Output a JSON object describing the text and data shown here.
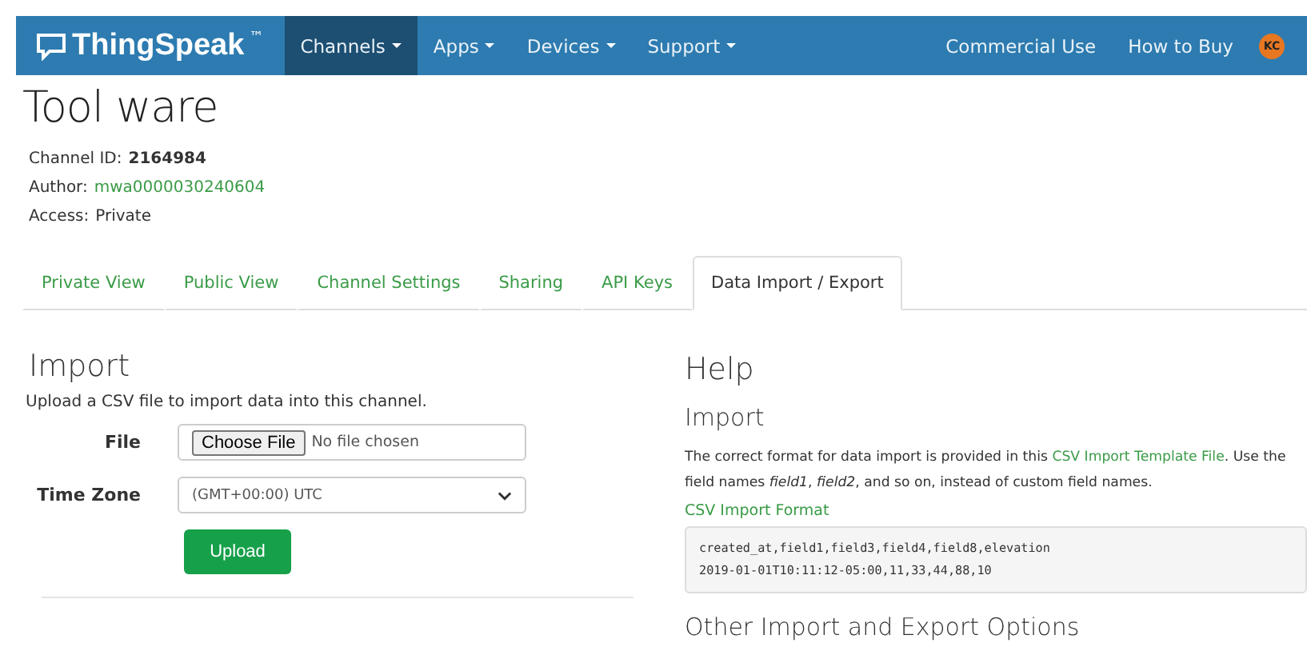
{
  "navbar": {
    "brand": "ThingSpeak",
    "trademark": "™",
    "menus": [
      {
        "label": "Channels",
        "selected": true,
        "caret": true
      },
      {
        "label": "Apps",
        "selected": false,
        "caret": true
      },
      {
        "label": "Devices",
        "selected": false,
        "caret": true
      },
      {
        "label": "Support",
        "selected": false,
        "caret": true
      }
    ],
    "links": [
      "Commercial Use",
      "How to Buy"
    ],
    "avatar": "KC"
  },
  "channel": {
    "title": "Tool ware",
    "info": [
      {
        "label": "Channel ID:",
        "value": "2164984",
        "kind": "bold"
      },
      {
        "label": "Author:",
        "value": "mwa0000030240604",
        "kind": "link"
      },
      {
        "label": "Access:",
        "value": "Private",
        "kind": "plain"
      }
    ]
  },
  "tabs": [
    {
      "label": "Private View",
      "selected": false
    },
    {
      "label": "Public View",
      "selected": false
    },
    {
      "label": "Channel Settings",
      "selected": false
    },
    {
      "label": "Sharing",
      "selected": false
    },
    {
      "label": "API Keys",
      "selected": false
    },
    {
      "label": "Data Import / Export",
      "selected": true
    }
  ],
  "import": {
    "heading": "Import",
    "description": "Upload a CSV file to import data into this channel.",
    "file": {
      "label": "File",
      "button": "Choose File",
      "status": "No file chosen"
    },
    "timezone": {
      "label": "Time Zone",
      "value": "(GMT+00:00) UTC"
    },
    "upload": "Upload"
  },
  "help": {
    "heading": "Help",
    "subheading": "Import",
    "text_before": "The correct format for data import is provided in this ",
    "link": "CSV Import Template File",
    "text_after": ". Use the field names *field1*, *field2*, and so on, instead of custom field names.",
    "format_label": "CSV Import Format",
    "code": [
      "created_at,field1,field3,field4,field8,elevation",
      "2019-01-01T10:11:12-05:00,11,33,44,88,10"
    ],
    "other_heading": "Other Import and Export Options"
  }
}
